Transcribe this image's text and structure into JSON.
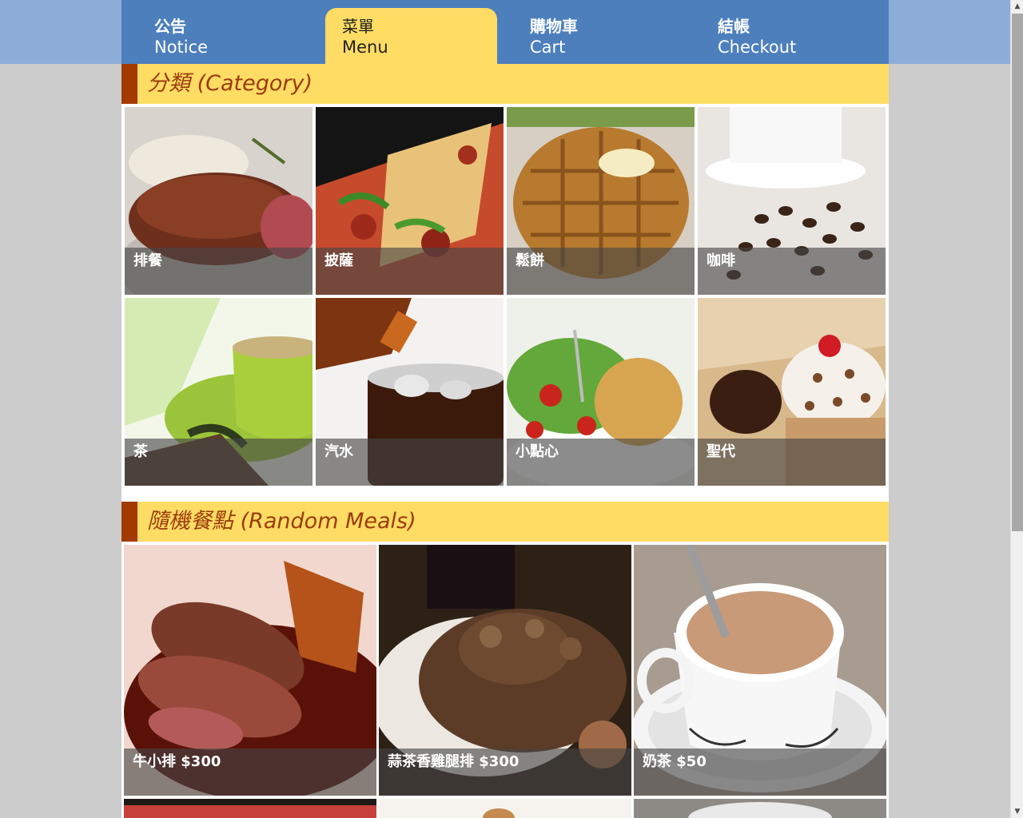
{
  "nav": {
    "tabs": [
      {
        "zh": "公告",
        "en": "Notice"
      },
      {
        "zh": "菜單",
        "en": "Menu"
      },
      {
        "zh": "購物車",
        "en": "Cart"
      },
      {
        "zh": "結帳",
        "en": "Checkout"
      }
    ],
    "active_tab": "Menu"
  },
  "sections": {
    "category": {
      "title": "分類 (Category)",
      "items": [
        {
          "label": "排餐"
        },
        {
          "label": "披薩"
        },
        {
          "label": "鬆餅"
        },
        {
          "label": "咖啡"
        },
        {
          "label": "茶"
        },
        {
          "label": "汽水"
        },
        {
          "label": "小點心"
        },
        {
          "label": "聖代"
        }
      ]
    },
    "random_meals": {
      "title": "隨機餐點 (Random Meals)",
      "items": [
        {
          "label": "牛小排 $300"
        },
        {
          "label": "蒜茶香雞腿排 $300"
        },
        {
          "label": "奶茶 $50"
        }
      ]
    }
  },
  "colors": {
    "nav_bg": "#4d7fbd",
    "active_tab": "#ffdc64",
    "section_bg": "#ffdc64",
    "section_accent": "#a33a00",
    "page_bg": "#cccccc"
  }
}
